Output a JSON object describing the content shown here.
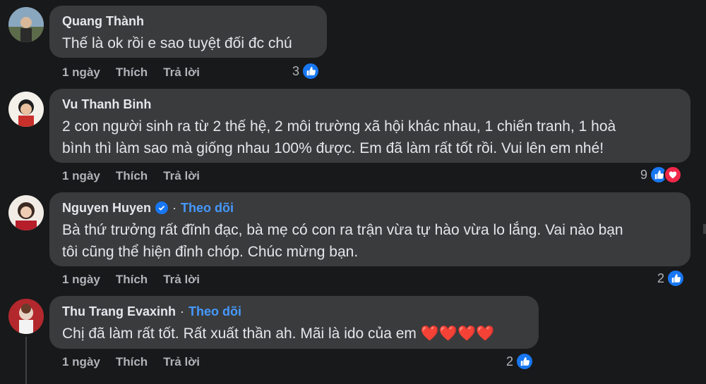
{
  "comments": [
    {
      "author": "Quang Thành",
      "text_lines": [
        "Thế là ok rồi e sao tuyệt đối đc chú"
      ],
      "time": "1 ngày",
      "like_label": "Thích",
      "reply_label": "Trả lời",
      "reaction_count": "3",
      "reactions": [
        "like-icon"
      ]
    },
    {
      "author": "Vu Thanh Binh",
      "text_lines": [
        "2 con người sinh ra từ 2 thế hệ, 2 môi trường xã hội khác nhau, 1 chiến tranh, 1 hoà",
        "bình thì làm sao mà giống nhau 100% được. Em đã làm rất tốt rồi. Vui lên em nhé!"
      ],
      "time": "1 ngày",
      "like_label": "Thích",
      "reply_label": "Trả lời",
      "reaction_count": "9",
      "reactions": [
        "like-icon",
        "love-icon"
      ]
    },
    {
      "author": "Nguyen Huyen",
      "verified": true,
      "separator": "·",
      "follow_label": "Theo dõi",
      "text_lines": [
        "Bà thứ trưởng rất đĩnh đạc, bà mẹ có con ra trận vừa tự hào vừa lo lắng. Vai nào bạn",
        "tôi cũng thể hiện đỉnh chóp. Chúc mừng bạn."
      ],
      "time": "1 ngày",
      "like_label": "Thích",
      "reply_label": "Trả lời",
      "reaction_count": "2",
      "reactions": [
        "like-icon"
      ]
    },
    {
      "author": "Thu Trang Evaxinh",
      "separator": "·",
      "follow_label": "Theo dõi",
      "text_lines": [
        "Chị đã làm rất tốt. Rất xuất thần ah. Mãi là ido của em ❤️❤️❤️❤️"
      ],
      "time": "1 ngày",
      "like_label": "Thích",
      "reply_label": "Trả lời",
      "reaction_count": "2",
      "reactions": [
        "like-icon"
      ]
    }
  ],
  "colors": {
    "background": "#18191a",
    "bubble": "#3a3b3c",
    "text": "#e4e6eb",
    "secondary": "#b0b3b8",
    "link": "#4599ff",
    "like": "#1877f2",
    "love": "#f0284a"
  }
}
